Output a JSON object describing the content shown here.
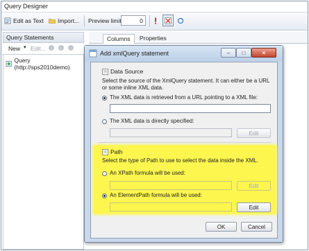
{
  "main": {
    "title": "Query Designer",
    "toolbar": {
      "edit_as_text": "Edit as Text",
      "import": "Import...",
      "preview_limit_label": "Preview limit:",
      "preview_limit_value": "0"
    },
    "left_panel": {
      "header": "Query Statements",
      "new_label": "New",
      "edit_label": "Edit...",
      "items": [
        "Query (http://sps2010demo)"
      ]
    },
    "tabs": [
      {
        "label": "Columns",
        "selected": true
      },
      {
        "label": "Properties",
        "selected": false
      }
    ]
  },
  "dialog": {
    "title": "Add xmlQuery statement",
    "data_source": {
      "title": "Data Source",
      "description": "Select the source of the XmlQuery statement. It can either be a URL or some inline XML data.",
      "option_url": "The XML data is retrieved from a URL pointing to a XML file:",
      "option_url_selected": true,
      "url_value": "",
      "option_inline": "The XML data is directly specified:",
      "option_inline_selected": false,
      "inline_value": "",
      "edit_label": "Edit"
    },
    "path": {
      "title": "Path",
      "description": "Select the type of Path to use to select the data inside the XML.",
      "option_xpath": "An XPath formula will be used:",
      "option_xpath_selected": false,
      "xpath_value": "",
      "option_elementpath": "An ElementPath formula will be used:",
      "option_elementpath_selected": true,
      "elementpath_value": "",
      "edit_label": "Edit",
      "highlight_color": "#fcf64f"
    },
    "ok_label": "OK",
    "cancel_label": "Cancel"
  }
}
